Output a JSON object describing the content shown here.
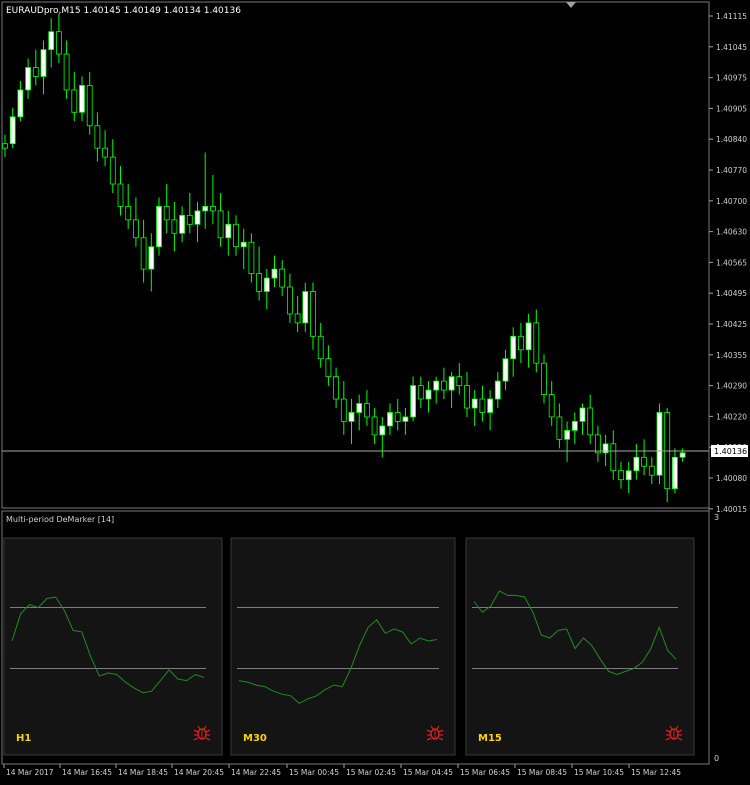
{
  "symbol_header": "EURAUDpro,M15  1.40145 1.40149 1.40134 1.40136",
  "price_axis": {
    "ticks": [
      "1.41115",
      "1.41045",
      "1.40975",
      "1.40905",
      "1.40840",
      "1.40770",
      "1.40700",
      "1.40630",
      "1.40565",
      "1.40495",
      "1.40425",
      "1.40355",
      "1.40290",
      "1.40220",
      "1.40150",
      "1.40080",
      "1.40015"
    ],
    "current_price": "1.40136"
  },
  "indicator": {
    "title": "Multi-period DeMarker [14]",
    "scale_top": "3",
    "scale_bottom": "0",
    "panels": [
      {
        "label": "H1",
        "values": [
          0.48,
          0.66,
          0.72,
          0.7,
          0.76,
          0.77,
          0.68,
          0.55,
          0.54,
          0.38,
          0.25,
          0.27,
          0.26,
          0.21,
          0.17,
          0.14,
          0.15,
          0.22,
          0.29,
          0.23,
          0.22,
          0.26,
          0.24
        ]
      },
      {
        "label": "M30",
        "values": [
          0.22,
          0.21,
          0.19,
          0.18,
          0.15,
          0.13,
          0.12,
          0.07,
          0.1,
          0.12,
          0.16,
          0.19,
          0.18,
          0.3,
          0.45,
          0.57,
          0.62,
          0.53,
          0.56,
          0.54,
          0.46,
          0.5,
          0.48,
          0.49
        ]
      },
      {
        "label": "M15",
        "values": [
          0.74,
          0.67,
          0.71,
          0.81,
          0.78,
          0.78,
          0.77,
          0.67,
          0.52,
          0.5,
          0.55,
          0.56,
          0.43,
          0.5,
          0.45,
          0.36,
          0.28,
          0.26,
          0.28,
          0.3,
          0.34,
          0.43,
          0.57,
          0.42,
          0.36
        ]
      }
    ]
  },
  "time_axis": [
    "14 Mar 2017",
    "14 Mar 16:45",
    "14 Mar 18:45",
    "14 Mar 20:45",
    "14 Mar 22:45",
    "15 Mar 00:45",
    "15 Mar 02:45",
    "15 Mar 04:45",
    "15 Mar 06:45",
    "15 Mar 08:45",
    "15 Mar 10:45",
    "15 Mar 12:45"
  ],
  "colors": {
    "background": "#000000",
    "bull_candle": "#ffffff",
    "bear_candle": "#000000",
    "wick": "#00ff00",
    "indicator_line": "#228b22",
    "panel_background": "#141414",
    "panel_border": "#3a3a3a",
    "level_line": "#a0a0a0",
    "panel_label": "#ffd200",
    "bug_icon": "#ff2020"
  },
  "candles": [
    [
      1.4083,
      1.4085,
      1.408,
      1.4082
    ],
    [
      1.4083,
      1.4091,
      1.4082,
      1.4089
    ],
    [
      1.4089,
      1.4097,
      1.4088,
      1.4095
    ],
    [
      1.4095,
      1.4102,
      1.4093,
      1.41
    ],
    [
      1.41,
      1.4104,
      1.4096,
      1.4098
    ],
    [
      1.4098,
      1.4106,
      1.4094,
      1.4104
    ],
    [
      1.4104,
      1.4111,
      1.41,
      1.4108
    ],
    [
      1.4108,
      1.4112,
      1.4101,
      1.4103
    ],
    [
      1.4103,
      1.4106,
      1.4093,
      1.4095
    ],
    [
      1.4095,
      1.4099,
      1.4088,
      1.409
    ],
    [
      1.409,
      1.4098,
      1.4088,
      1.4096
    ],
    [
      1.4096,
      1.4099,
      1.4085,
      1.4087
    ],
    [
      1.4087,
      1.409,
      1.4079,
      1.4082
    ],
    [
      1.4082,
      1.4086,
      1.4078,
      1.408
    ],
    [
      1.408,
      1.4084,
      1.4072,
      1.4074
    ],
    [
      1.4074,
      1.4078,
      1.4067,
      1.4069
    ],
    [
      1.4069,
      1.4074,
      1.4064,
      1.4066
    ],
    [
      1.4066,
      1.4071,
      1.406,
      1.4062
    ],
    [
      1.4062,
      1.4066,
      1.4052,
      1.4055
    ],
    [
      1.4055,
      1.4063,
      1.405,
      1.406
    ],
    [
      1.406,
      1.4071,
      1.4058,
      1.4069
    ],
    [
      1.4069,
      1.4074,
      1.4063,
      1.4066
    ],
    [
      1.4066,
      1.407,
      1.4059,
      1.4063
    ],
    [
      1.4063,
      1.4069,
      1.4061,
      1.4067
    ],
    [
      1.4067,
      1.4072,
      1.4063,
      1.4065
    ],
    [
      1.4065,
      1.407,
      1.4061,
      1.4068
    ],
    [
      1.4068,
      1.4081,
      1.4064,
      1.4069
    ],
    [
      1.4069,
      1.4076,
      1.4065,
      1.4068
    ],
    [
      1.4068,
      1.4072,
      1.406,
      1.4062
    ],
    [
      1.4062,
      1.4068,
      1.4058,
      1.4065
    ],
    [
      1.4065,
      1.4067,
      1.4058,
      1.406
    ],
    [
      1.406,
      1.4064,
      1.4055,
      1.4061
    ],
    [
      1.4061,
      1.4063,
      1.4052,
      1.4054
    ],
    [
      1.4054,
      1.406,
      1.4048,
      1.405
    ],
    [
      1.405,
      1.4055,
      1.4046,
      1.4053
    ],
    [
      1.4053,
      1.4058,
      1.4051,
      1.4055
    ],
    [
      1.4055,
      1.4057,
      1.4049,
      1.4051
    ],
    [
      1.4051,
      1.4054,
      1.4043,
      1.4045
    ],
    [
      1.4045,
      1.4049,
      1.4041,
      1.4043
    ],
    [
      1.4043,
      1.4052,
      1.4041,
      1.405
    ],
    [
      1.405,
      1.4052,
      1.4037,
      1.404
    ],
    [
      1.404,
      1.4043,
      1.4033,
      1.4035
    ],
    [
      1.4035,
      1.4038,
      1.4029,
      1.4031
    ],
    [
      1.4031,
      1.4033,
      1.4024,
      1.4026
    ],
    [
      1.4026,
      1.403,
      1.4018,
      1.4021
    ],
    [
      1.4021,
      1.4026,
      1.4016,
      1.4023
    ],
    [
      1.4023,
      1.4027,
      1.4019,
      1.4025
    ],
    [
      1.4025,
      1.4028,
      1.402,
      1.4022
    ],
    [
      1.4022,
      1.4024,
      1.4016,
      1.4018
    ],
    [
      1.4018,
      1.4022,
      1.4013,
      1.402
    ],
    [
      1.402,
      1.4025,
      1.4018,
      1.4023
    ],
    [
      1.4023,
      1.4026,
      1.4019,
      1.4021
    ],
    [
      1.4021,
      1.4024,
      1.4018,
      1.4022
    ],
    [
      1.4022,
      1.4031,
      1.4021,
      1.4029
    ],
    [
      1.4029,
      1.4031,
      1.4024,
      1.4026
    ],
    [
      1.4026,
      1.403,
      1.4023,
      1.4028
    ],
    [
      1.4028,
      1.4031,
      1.4025,
      1.403
    ],
    [
      1.403,
      1.4033,
      1.4026,
      1.4028
    ],
    [
      1.4028,
      1.4032,
      1.4024,
      1.4031
    ],
    [
      1.4031,
      1.4034,
      1.4027,
      1.4029
    ],
    [
      1.4029,
      1.4032,
      1.4022,
      1.4024
    ],
    [
      1.4024,
      1.4028,
      1.402,
      1.4026
    ],
    [
      1.4026,
      1.4029,
      1.4021,
      1.4023
    ],
    [
      1.4023,
      1.4028,
      1.4019,
      1.4026
    ],
    [
      1.4026,
      1.4032,
      1.4024,
      1.403
    ],
    [
      1.403,
      1.4037,
      1.4028,
      1.4035
    ],
    [
      1.4035,
      1.4042,
      1.4031,
      1.404
    ],
    [
      1.404,
      1.4043,
      1.4034,
      1.4037
    ],
    [
      1.4037,
      1.4045,
      1.4033,
      1.4043
    ],
    [
      1.4043,
      1.4046,
      1.4032,
      1.4034
    ],
    [
      1.4034,
      1.4036,
      1.4025,
      1.4027
    ],
    [
      1.4027,
      1.403,
      1.402,
      1.4022
    ],
    [
      1.4022,
      1.4025,
      1.4015,
      1.4017
    ],
    [
      1.4017,
      1.4021,
      1.4012,
      1.4019
    ],
    [
      1.4019,
      1.4023,
      1.4016,
      1.4021
    ],
    [
      1.4021,
      1.4025,
      1.4018,
      1.4024
    ],
    [
      1.4024,
      1.4027,
      1.4016,
      1.4018
    ],
    [
      1.4018,
      1.402,
      1.4012,
      1.4014
    ],
    [
      1.4014,
      1.4018,
      1.4011,
      1.4016
    ],
    [
      1.4016,
      1.4019,
      1.4008,
      1.401
    ],
    [
      1.401,
      1.4012,
      1.4006,
      1.4008
    ],
    [
      1.4008,
      1.4012,
      1.4005,
      1.401
    ],
    [
      1.401,
      1.4016,
      1.4008,
      1.4013
    ],
    [
      1.4013,
      1.4017,
      1.4009,
      1.4011
    ],
    [
      1.4011,
      1.4013,
      1.4007,
      1.4009
    ],
    [
      1.4009,
      1.4025,
      1.4007,
      1.4023
    ],
    [
      1.4023,
      1.4024,
      1.4003,
      1.4006
    ],
    [
      1.4006,
      1.4015,
      1.4005,
      1.4013
    ],
    [
      1.4013,
      1.4015,
      1.4012,
      1.4014
    ]
  ]
}
